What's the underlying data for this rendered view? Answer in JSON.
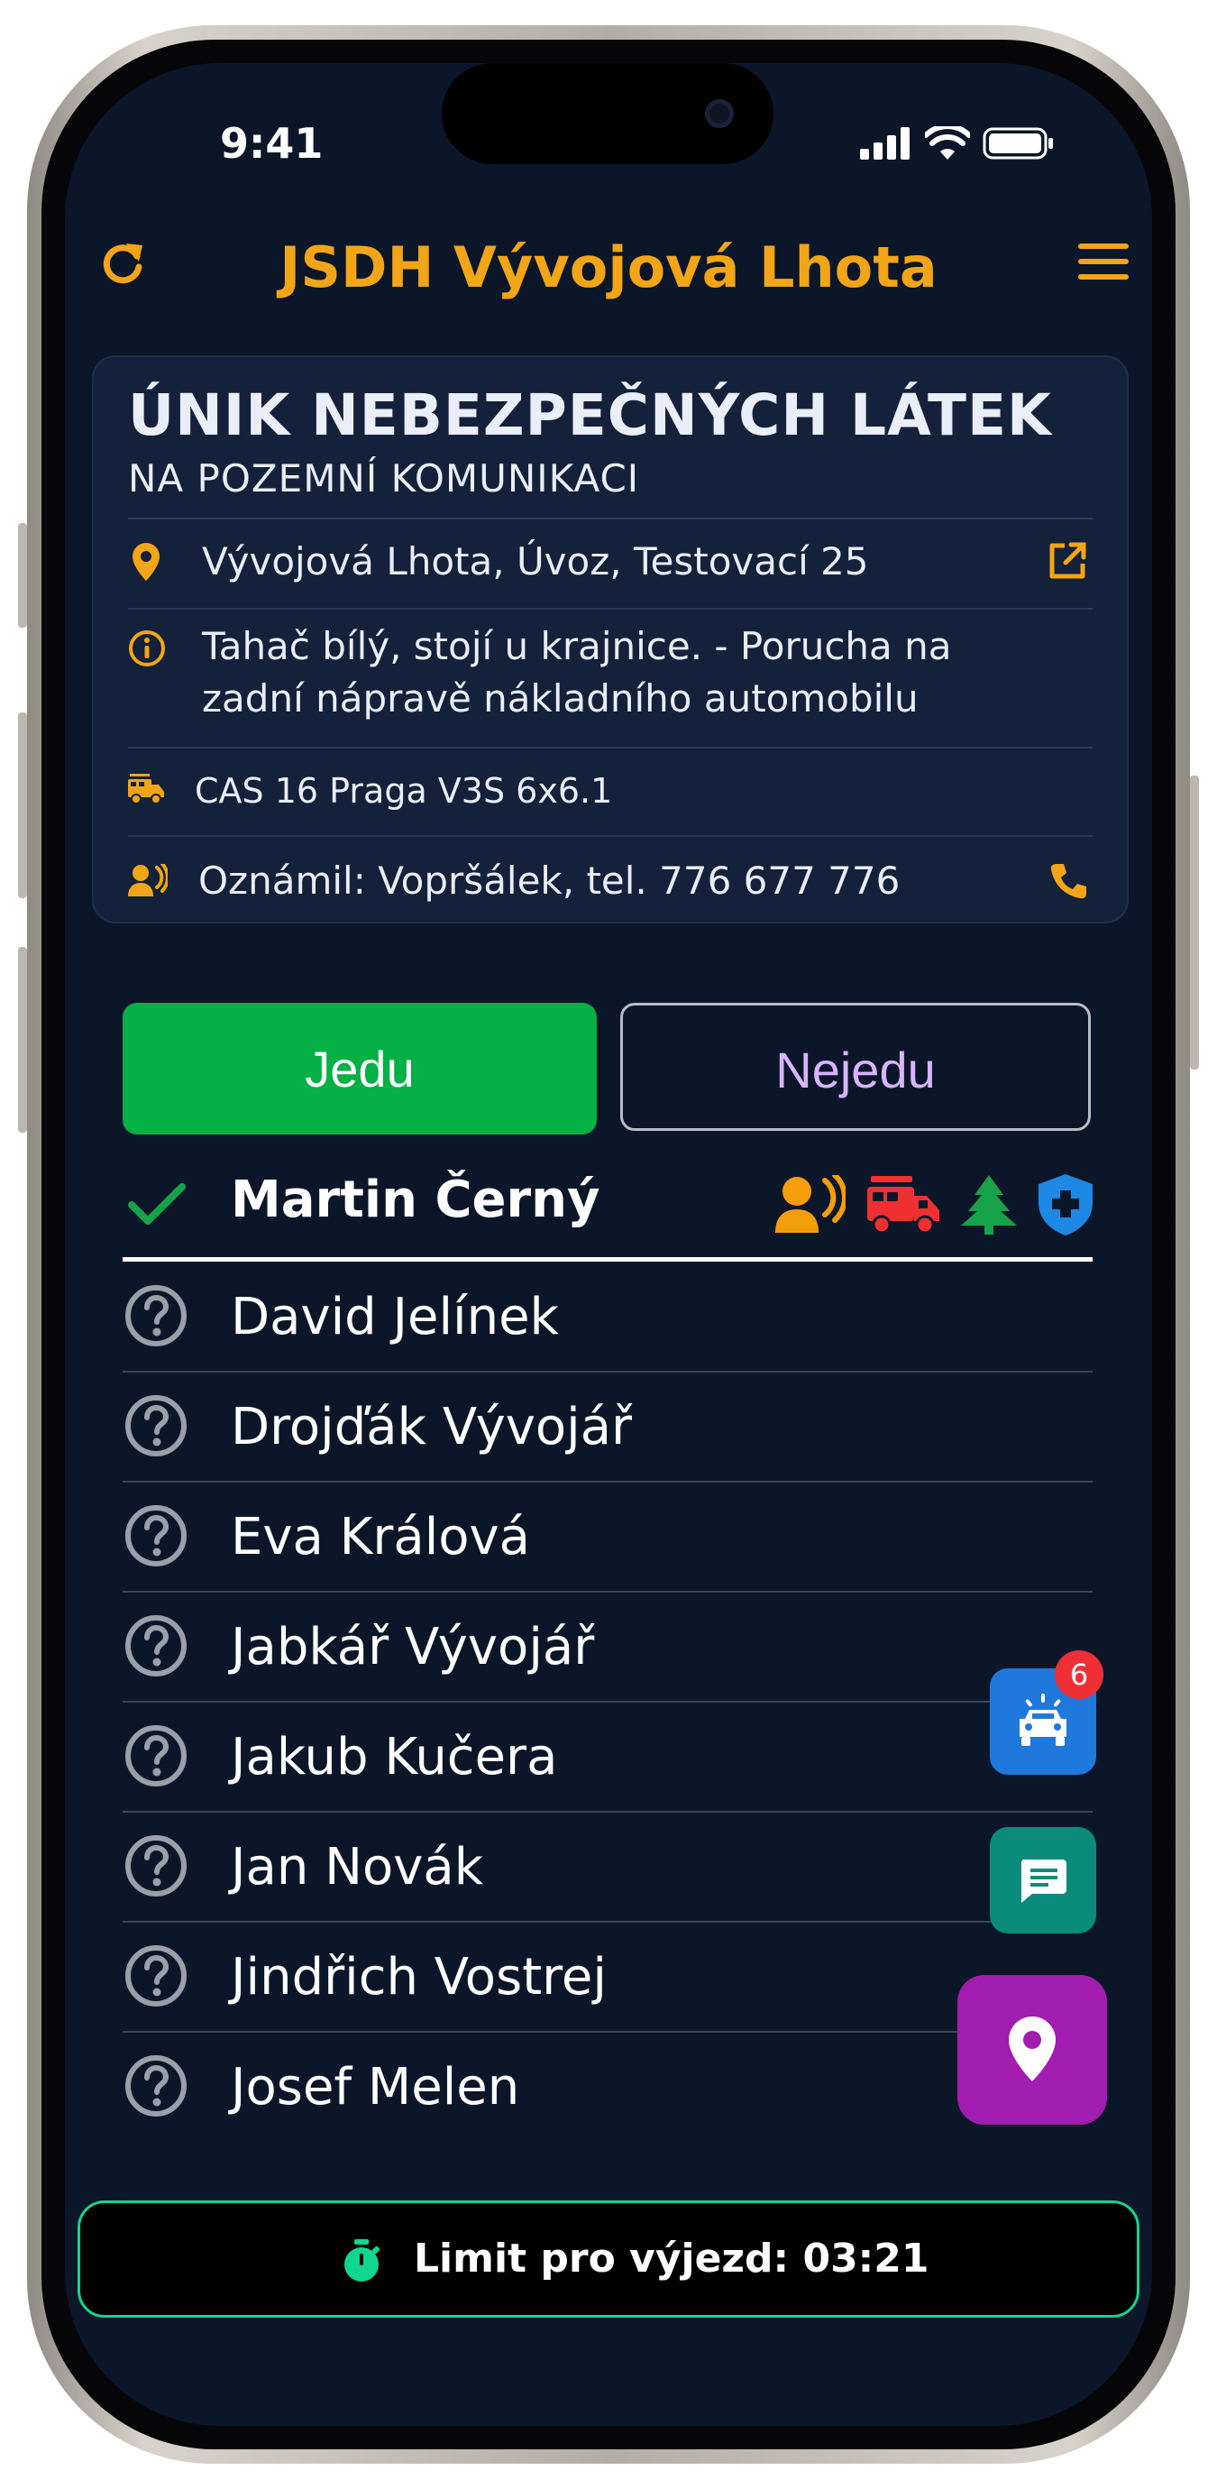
{
  "status": {
    "time": "9:41"
  },
  "appbar": {
    "title": "JSDH Vývojová Lhota"
  },
  "incident": {
    "title": "ÚNIK NEBEZPEČNÝCH LÁTEK",
    "subtitle": "NA POZEMNÍ KOMUNIKACI",
    "address": "Vývojová Lhota, Úvoz, Testovací 25",
    "note_line1": "Tahač bílý, stojí u krajnice. - Porucha na",
    "note_line2": "zadní nápravě nákladního automobilu",
    "vehicle": "CAS 16 Praga V3S 6x6.1",
    "reporter": "Oznámil: Vopršálek, tel. 776 677 776"
  },
  "actions": {
    "go_label": "Jedu",
    "no_label": "Nejedu"
  },
  "responders": {
    "confirmed": {
      "name": "Martin Černý"
    },
    "unknown": [
      "David Jelínek",
      "Drojďák Vývojář",
      "Eva Králová",
      "Jabkář Vývojář",
      "Jakub Kučera",
      "Jan Novák",
      "Jindřich Vostrej",
      "Josef Melen"
    ]
  },
  "fabs": {
    "vehicles_badge": "6"
  },
  "limit": {
    "label": "Limit pro výjezd: 03:21"
  },
  "colors": {
    "accent": "#f2a516",
    "background": "#0c1629",
    "card": "#13213a",
    "go": "#05b045",
    "no_text": "#d8b4fe",
    "role_caller": "#f59e0b",
    "role_firetruck": "#ef3030",
    "role_tree": "#16a34a",
    "role_medic": "#1e88e5",
    "fab_vehicles": "#1f79dd",
    "fab_chat": "#0b8c7a",
    "fab_map": "#a21caf",
    "limit_border": "#10d68f"
  },
  "icons": {
    "refresh": "refresh-icon",
    "menu": "menu-icon",
    "location": "location-pin-icon",
    "open": "open-external-icon",
    "info": "info-icon",
    "truck": "fire-truck-icon",
    "caller": "caller-icon",
    "phone": "phone-icon",
    "check": "check-icon",
    "unknown": "question-circle-icon",
    "car": "car-alert-icon",
    "chat": "chat-icon",
    "map": "map-pin-icon",
    "timer": "timer-icon"
  }
}
